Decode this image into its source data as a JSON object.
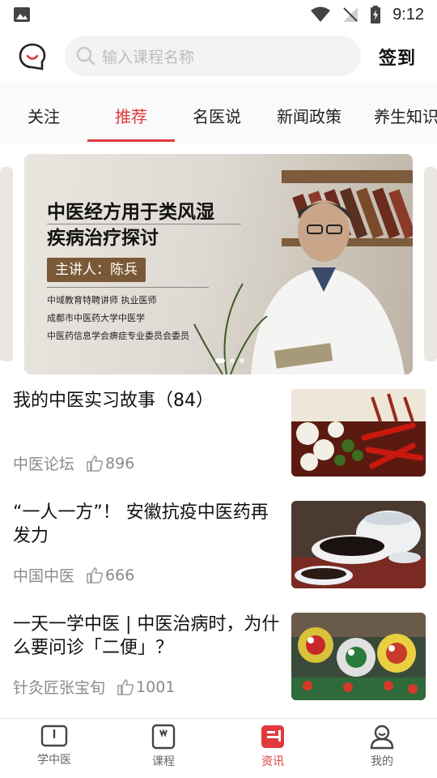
{
  "status_bar": {
    "time": "9:12"
  },
  "header": {
    "search_placeholder": "输入课程名称",
    "signin_label": "签到"
  },
  "tabs": [
    {
      "label": "关注",
      "active": false
    },
    {
      "label": "推荐",
      "active": true
    },
    {
      "label": "名医说",
      "active": false
    },
    {
      "label": "新闻政策",
      "active": false
    },
    {
      "label": "养生知识",
      "active": false
    }
  ],
  "banner": {
    "title_line1": "中医经方用于类风湿",
    "title_line2": "疾病治疗探讨",
    "speaker": "主讲人：陈兵",
    "line1": "中域教育特聘讲师 执业医师",
    "line2": "成都市中医药大学中医学",
    "line3": "中医药信息学会痹症专业委员会委员"
  },
  "news": [
    {
      "title": "我的中医实习故事（84）",
      "source": "中医论坛",
      "likes": "896",
      "thumb_icon": "chili-garlic-image"
    },
    {
      "title": "“一人一方”！ 安徽抗疫中医药再发力",
      "source": "中国中医",
      "likes": "666",
      "thumb_icon": "herbal-medicine-bowl-image"
    },
    {
      "title": "一天一学中医 | 中医治病时，为什么要问诊「二便」？",
      "source": "针灸匠张宝旬",
      "likes": "1001",
      "thumb_icon": "lion-dance-image"
    }
  ],
  "bottom_nav": [
    {
      "label": "学中医",
      "icon": "book-open-icon",
      "active": false
    },
    {
      "label": "课程",
      "icon": "notebook-icon",
      "active": false
    },
    {
      "label": "资讯",
      "icon": "news-icon",
      "active": true
    },
    {
      "label": "我的",
      "icon": "user-icon",
      "active": false
    }
  ],
  "colors": {
    "accent": "#e0393e",
    "text": "#111111",
    "muted": "#8a8a8a"
  }
}
